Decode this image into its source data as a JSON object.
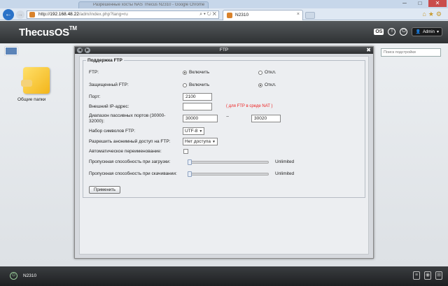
{
  "browser": {
    "other_tab_title": "Разрешенные хосты NAS Thecus N2310 - Google Chrome",
    "url_domain": "192.168.48.22",
    "url_path": "/adm/index.php?lang=ru",
    "active_tab_title": "N2310",
    "win_min": "─",
    "win_max": "□",
    "win_close": "✕"
  },
  "header": {
    "logo": "ThecusOS",
    "logo_tm": "TM",
    "os_badge": "OS",
    "admin_label": "Admin"
  },
  "desktop": {
    "folder_label": "Общие папки",
    "search_placeholder": "Поиск подстройки"
  },
  "window": {
    "title": "FTP",
    "section_title": "Поддержка FTP",
    "ftp": {
      "label": "FTP:",
      "on": "Включить",
      "off": "Откл.",
      "selected": "on"
    },
    "secure_ftp": {
      "label": "Защищенный FTP:",
      "on": "Включить",
      "off": "Откл.",
      "selected": "off"
    },
    "port": {
      "label": "Порт:",
      "value": "2100"
    },
    "external_ip": {
      "label": "Внешний IP-адрес:",
      "value": "",
      "note": "( для FTP в среде NAT )"
    },
    "passive_range": {
      "label": "Диапазон пассивных портов (30000-32000):",
      "from": "30000",
      "to": "30020",
      "separator": "~"
    },
    "charset": {
      "label": "Набор символов FTP:",
      "value": "UTF-8"
    },
    "anonymous": {
      "label": "Разрешить анонимный доступ на FTP:",
      "value": "Нет доступа"
    },
    "auto_rename": {
      "label": "Автоматическое переименование:",
      "checked": false
    },
    "upload_bandwidth": {
      "label": "Пропускная способность при загрузки:",
      "value": "Unlimited"
    },
    "download_bandwidth": {
      "label": "Пропускная способность при скачивании:",
      "value": "Unlimited"
    },
    "apply_label": "Применить"
  },
  "taskbar": {
    "device_name": "N2310"
  }
}
